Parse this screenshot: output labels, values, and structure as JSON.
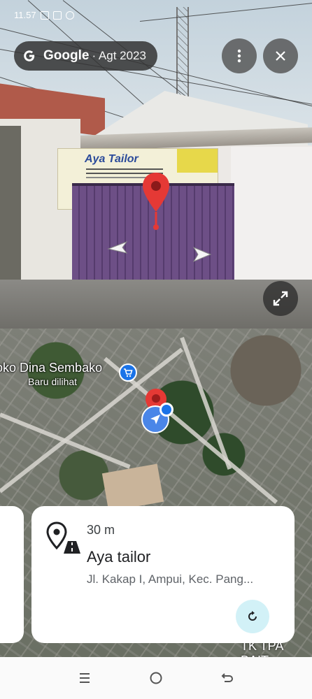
{
  "status_bar": {
    "time": "11.57"
  },
  "street_view": {
    "attribution": {
      "brand": "Google",
      "date": "· Agt 2023"
    },
    "shop_sign": "Aya Tailor",
    "icons": {
      "more": "more-vert-icon",
      "close": "close-icon",
      "expand": "expand-icon",
      "left": "arrow-left-icon",
      "right": "arrow-right-icon"
    }
  },
  "map": {
    "place_label": "oko Dina Sembako",
    "place_sublabel": "Baru dilihat",
    "bottom_label": "TK TPA BAIT"
  },
  "place_card": {
    "distance": "30 m",
    "name": "Aya tailor",
    "address": "Jl. Kakap I, Ampui, Kec. Pang..."
  },
  "system_nav": {
    "icons": [
      "recent-apps-icon",
      "home-icon",
      "back-icon"
    ]
  },
  "colors": {
    "pin_red": "#e53935",
    "blue": "#1a73e8",
    "card_button_bg": "#d2f1f7"
  }
}
